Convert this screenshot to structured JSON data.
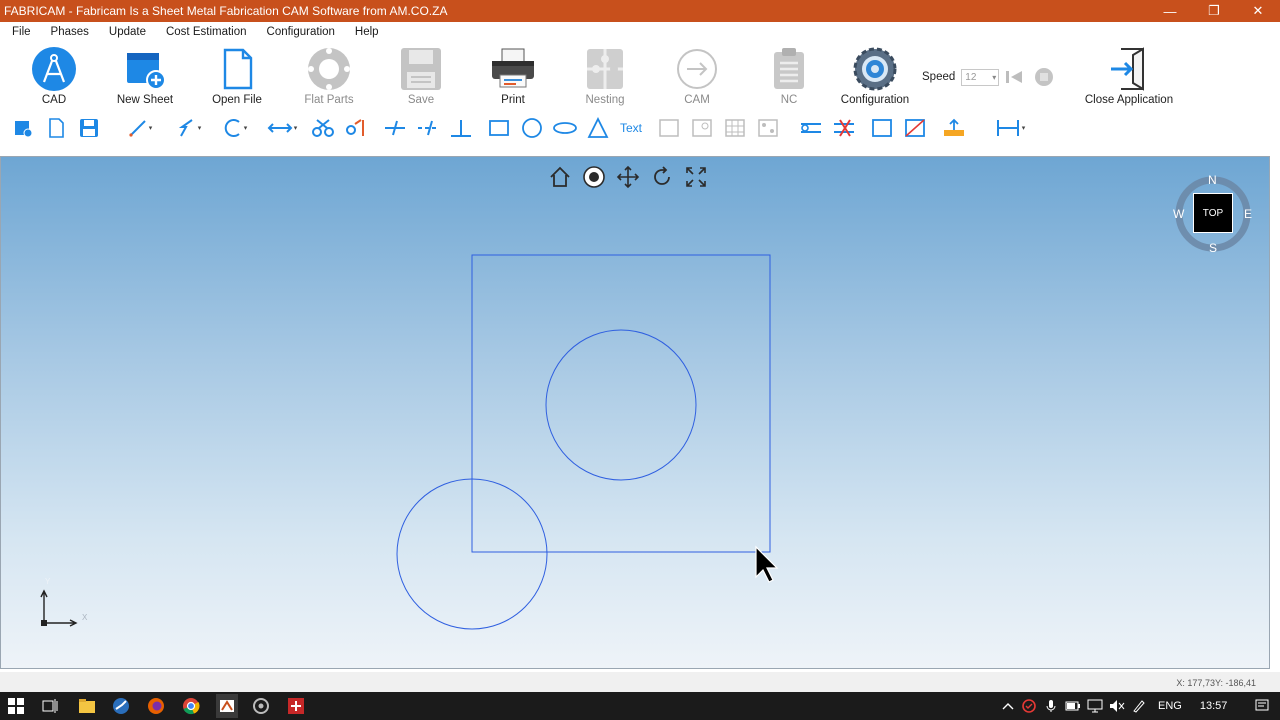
{
  "window": {
    "title": "FABRICAM - Fabricam Is a Sheet Metal Fabrication CAM Software from AM.CO.ZA"
  },
  "menu": [
    "File",
    "Phases",
    "Update",
    "Cost Estimation",
    "Configuration",
    "Help"
  ],
  "ribbon": {
    "cad": "CAD",
    "new_sheet": "New Sheet",
    "open_file": "Open File",
    "flat_parts": "Flat Parts",
    "save": "Save",
    "print": "Print",
    "nesting": "Nesting",
    "cam": "CAM",
    "nc": "NC",
    "configuration": "Configuration",
    "speed_label": "Speed",
    "speed_value": "12",
    "close_application": "Close Application"
  },
  "toolbar": {
    "text_tool": "Text"
  },
  "viewcube": {
    "top": "TOP",
    "north": "N",
    "south": "S",
    "east": "E",
    "west": "W"
  },
  "axis": {
    "x": "X",
    "y": "Y"
  },
  "status": {
    "coordinates": "X: 177,73Y: -186,41"
  },
  "taskbar": {
    "language": "ENG",
    "time": "13:57"
  },
  "colors": {
    "titlebar": "#c8501c",
    "geometry": "#2f5fe0",
    "accent": "#1e88e5"
  }
}
